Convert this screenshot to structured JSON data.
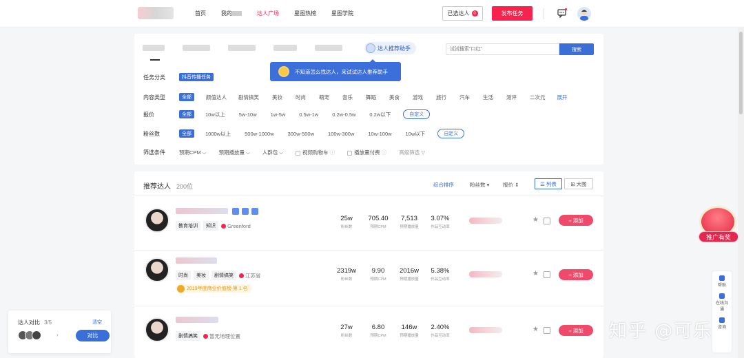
{
  "nav": {
    "items": [
      {
        "label": "首页",
        "active": false
      },
      {
        "label": "我的",
        "active": false
      },
      {
        "label": "达人广场",
        "active": true
      },
      {
        "label": "星图热榜",
        "active": false
      },
      {
        "label": "星图学院",
        "active": false
      }
    ],
    "selected_label": "已选达人",
    "selected_count": "0",
    "publish_label": "发布任务"
  },
  "filter": {
    "assistant_label": "达人推荐助手",
    "search_placeholder": "试试搜索\"口红\"",
    "search_button": "搜索",
    "tooltip": "不知道怎么找达人，来试试达人推荐助手",
    "task_category": {
      "label": "任务分类",
      "value": "抖音传播任务"
    },
    "content_type": {
      "label": "内容类型",
      "selected": "全部",
      "options": [
        "颜值达人",
        "剧情搞笑",
        "美妆",
        "时尚",
        "萌宠",
        "音乐",
        "舞蹈",
        "美食",
        "游戏",
        "旅行",
        "汽车",
        "生活",
        "测评",
        "二次元"
      ],
      "more": "展开"
    },
    "price": {
      "label": "报价",
      "selected": "全部",
      "options": [
        "10w以上",
        "5w-10w",
        "1w-5w",
        "0.5w-1w",
        "0.2w-0.5w",
        "0.2w以下"
      ],
      "custom": "自定义"
    },
    "fans": {
      "label": "粉丝数",
      "selected": "全部",
      "options": [
        "1000w以上",
        "500w-1000w",
        "300w-500w",
        "100w-300w",
        "10w-100w",
        "10w以下"
      ],
      "custom": "自定义"
    },
    "conditions": {
      "label": "筛选条件",
      "dropdowns": [
        "预期CPM",
        "预期播放量",
        "人群包"
      ],
      "checkboxes": [
        "视频购物车",
        "播放量付费"
      ],
      "advanced": "高级筛选"
    }
  },
  "list": {
    "title": "推荐达人",
    "count": "200位",
    "sort": [
      "综合排序",
      "粉丝数",
      "报价"
    ],
    "view_list": "列表",
    "view_big": "大图",
    "stat_labels": [
      "粉丝数",
      "预期CPM",
      "预期播放量",
      "作品互动率"
    ],
    "add_label": "+ 添加",
    "rows": [
      {
        "tags": [
          "教育培训",
          "知识"
        ],
        "location": "Greenford",
        "award": "",
        "stats": [
          "25w",
          "705.40",
          "7,513",
          "3.07%"
        ]
      },
      {
        "tags": [
          "时尚",
          "美妆",
          "剧情搞笑"
        ],
        "location": "江苏省",
        "award": "2019年度商业价值榜-第 1 名",
        "stats": [
          "2319w",
          "9.90",
          "2016w",
          "5.38%"
        ]
      },
      {
        "tags": [
          "剧情搞笑"
        ],
        "location": "暂无地理位置",
        "award": "",
        "stats": [
          "27w",
          "6.80",
          "146w",
          "2.40%"
        ]
      }
    ]
  },
  "compare": {
    "title": "达人对比",
    "count": "3/5",
    "clear": "清空",
    "button": "对比"
  },
  "promo": {
    "label": "推广有奖"
  },
  "side_tools": [
    "帮助",
    "在线沟通",
    "咨询"
  ],
  "watermark": "知乎 @可乐",
  "colors": {
    "brand_red": "#f5234d",
    "primary_blue": "#3b6fd8"
  }
}
